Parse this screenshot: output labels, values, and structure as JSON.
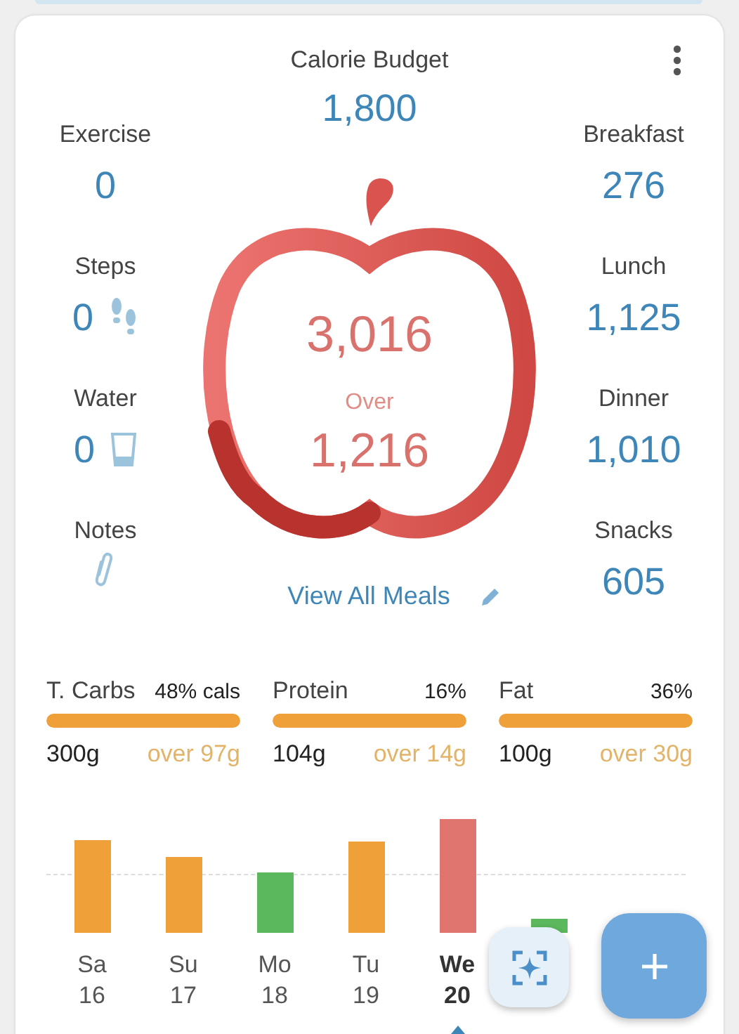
{
  "budget": {
    "label": "Calorie Budget",
    "value": "1,800"
  },
  "left_stats": [
    {
      "label": "Exercise",
      "value": "0"
    },
    {
      "kind": "steps",
      "label": "Steps",
      "value": "0"
    },
    {
      "kind": "water",
      "label": "Water",
      "value": "0"
    },
    {
      "kind": "notes",
      "label": "Notes"
    }
  ],
  "right_stats": [
    {
      "label": "Breakfast",
      "value": "276"
    },
    {
      "label": "Lunch",
      "value": "1,125"
    },
    {
      "label": "Dinner",
      "value": "1,010"
    },
    {
      "label": "Snacks",
      "value": "605"
    }
  ],
  "apple": {
    "total": "3,016",
    "status": "Over",
    "difference": "1,216"
  },
  "view_all_link": "View All Meals",
  "macros": [
    {
      "label": "T. Carbs",
      "percent": "48% cals",
      "grams": "300g",
      "over": "over 97g",
      "level": 1
    },
    {
      "label": "Protein",
      "percent": "16%",
      "grams": "104g",
      "over": "over 14g",
      "level": 1
    },
    {
      "label": "Fat",
      "percent": "36%",
      "grams": "100g",
      "over": "over 30g",
      "level": 1
    }
  ],
  "days": [
    {
      "day": "Sa",
      "date": "16",
      "color": "#f0a038",
      "selected": false
    },
    {
      "day": "Su",
      "date": "17",
      "color": "#f0a038",
      "selected": false
    },
    {
      "day": "Mo",
      "date": "18",
      "color": "#5cb85c",
      "selected": false
    },
    {
      "day": "Tu",
      "date": "19",
      "color": "#f0a038",
      "selected": false
    },
    {
      "day": "We",
      "date": "20",
      "color": "#e07570",
      "selected": true
    },
    {
      "color": "#5cb85c"
    }
  ]
}
